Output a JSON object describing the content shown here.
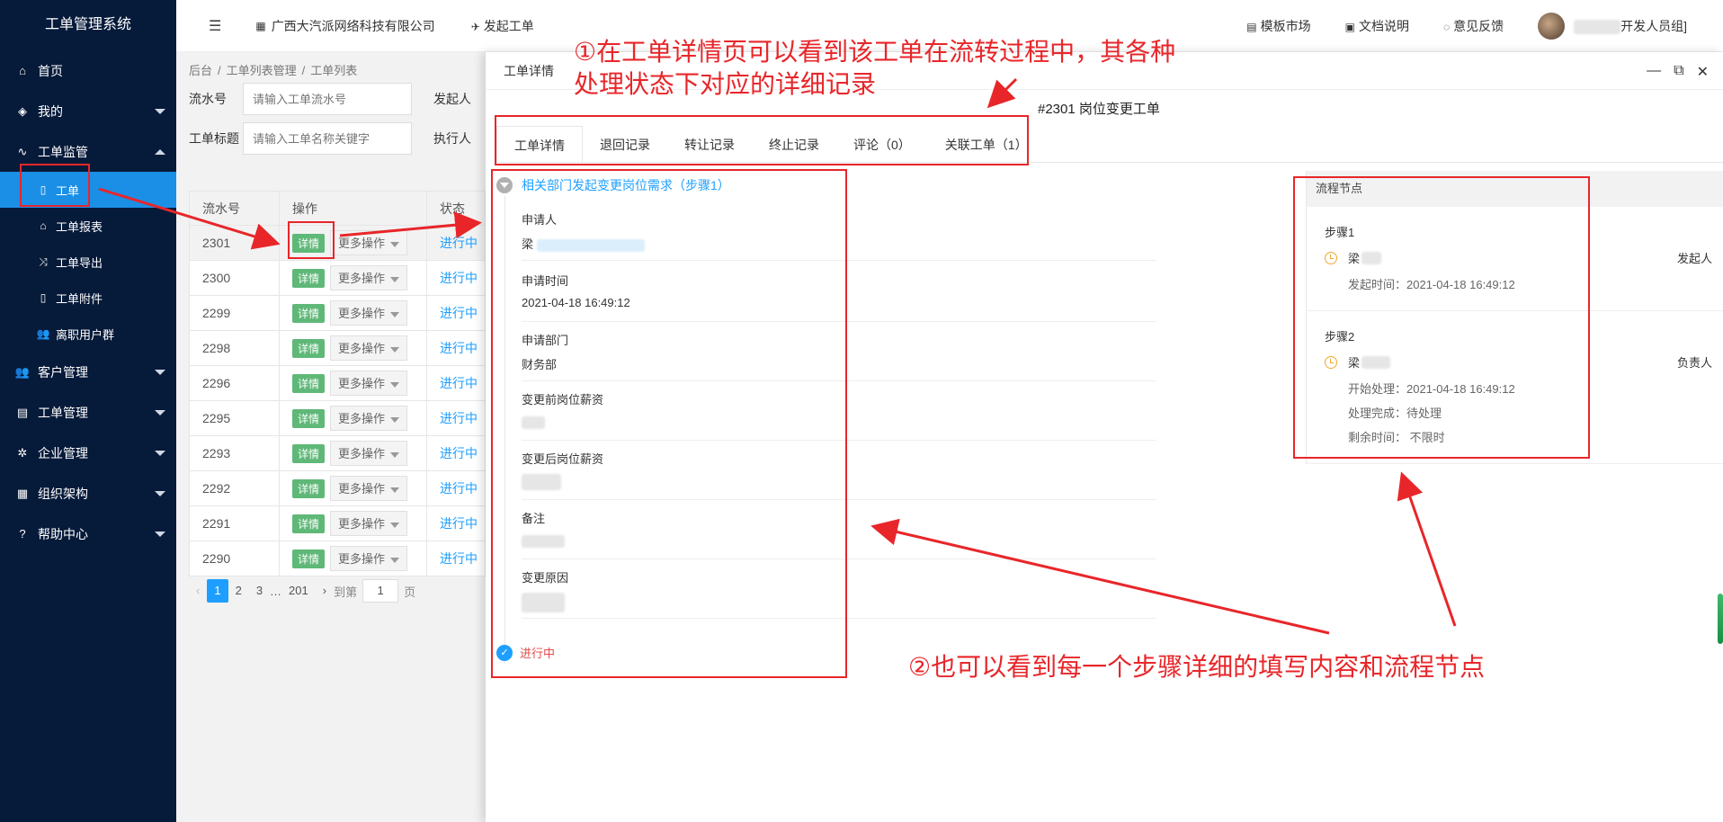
{
  "sidebar": {
    "brand": "工单管理系统",
    "items": [
      {
        "label": "首页",
        "icon": "home-icon",
        "glyph": "⌂"
      },
      {
        "label": "我的",
        "icon": "layers-icon",
        "glyph": "◈"
      },
      {
        "label": "工单监管",
        "icon": "pulse-icon",
        "glyph": "∿"
      },
      {
        "label": "客户管理",
        "icon": "users-icon",
        "glyph": "👥"
      },
      {
        "label": "工单管理",
        "icon": "clipboard-icon",
        "glyph": "▤"
      },
      {
        "label": "企业管理",
        "icon": "gear-icon",
        "glyph": "✲"
      },
      {
        "label": "组织架构",
        "icon": "calendar-icon",
        "glyph": "▦"
      },
      {
        "label": "帮助中心",
        "icon": "question-icon",
        "glyph": "?"
      }
    ],
    "sub_items": [
      {
        "label": "工单",
        "icon": "document-icon",
        "glyph": "▯"
      },
      {
        "label": "工单报表",
        "icon": "home-outline-icon",
        "glyph": "⌂"
      },
      {
        "label": "工单导出",
        "icon": "export-icon",
        "glyph": "⤨"
      },
      {
        "label": "工单附件",
        "icon": "file-icon",
        "glyph": "▯"
      },
      {
        "label": "离职用户群",
        "icon": "users-icon",
        "glyph": "👥"
      }
    ]
  },
  "header": {
    "company": "广西大汽派网络科技有限公司",
    "launch": "发起工单",
    "links": [
      "模板市场",
      "文档说明",
      "意见反馈"
    ],
    "user_suffix": "开发人员组]"
  },
  "list": {
    "breadcrumb": [
      "后台",
      "工单列表管理",
      "工单列表"
    ],
    "filter_serial_label": "流水号",
    "filter_serial_placeholder": "请输入工单流水号",
    "filter_initiator_label": "发起人",
    "filter_title_label": "工单标题",
    "filter_title_placeholder": "请输入工单名称关键字",
    "filter_executor_label": "执行人",
    "columns": [
      "流水号",
      "操作",
      "状态"
    ],
    "detail_label": "详情",
    "more_label": "更多操作",
    "rows": [
      {
        "id": "2301",
        "status": "进行中"
      },
      {
        "id": "2300",
        "status": "进行中"
      },
      {
        "id": "2299",
        "status": "进行中"
      },
      {
        "id": "2298",
        "status": "进行中"
      },
      {
        "id": "2296",
        "status": "进行中"
      },
      {
        "id": "2295",
        "status": "进行中"
      },
      {
        "id": "2293",
        "status": "进行中"
      },
      {
        "id": "2292",
        "status": "进行中"
      },
      {
        "id": "2291",
        "status": "进行中"
      },
      {
        "id": "2290",
        "status": "进行中"
      }
    ],
    "pager": {
      "pages": [
        "1",
        "2",
        "3",
        "…",
        "201"
      ],
      "goto_label": "到第",
      "goto_value": "1",
      "page_unit": "页"
    }
  },
  "drawer": {
    "title": "工单详情",
    "work_order_title": "#2301 岗位变更工单",
    "tabs": [
      "工单详情",
      "退回记录",
      "转让记录",
      "终止记录",
      "评论（0）",
      "关联工单（1）"
    ],
    "step_title": "相关部门发起变更岗位需求（步骤1）",
    "fields": [
      {
        "key": "申请人",
        "value": "梁"
      },
      {
        "key": "申请时间",
        "value": "2021-04-18 16:49:12"
      },
      {
        "key": "申请部门",
        "value": "财务部"
      },
      {
        "key": "变更前岗位薪资",
        "value": ""
      },
      {
        "key": "变更后岗位薪资",
        "value": ""
      },
      {
        "key": "备注",
        "value": ""
      },
      {
        "key": "变更原因",
        "value": ""
      }
    ],
    "status": "进行中",
    "flow": {
      "header": "流程节点",
      "nodes": [
        {
          "step": "步骤1",
          "person": "梁",
          "role": "发起人",
          "meta": [
            "发起时间：2021-04-18 16:49:12"
          ]
        },
        {
          "step": "步骤2",
          "person": "梁",
          "role": "负责人",
          "meta": [
            "开始处理：2021-04-18 16:49:12",
            "处理完成：待处理",
            "剩余时间： 不限时"
          ]
        }
      ]
    }
  },
  "annotations": {
    "note1": "①在工单详情页可以看到该工单在流转过程中，其各种处理状态下对应的详细记录",
    "note1_line1": "①在工单详情页可以看到该工单在流转过程中，其各种",
    "note1_line2": "处理状态下对应的详细记录",
    "note2": "②也可以看到每一个步骤详细的填写内容和流程节点"
  },
  "colors": {
    "sidebar_bg": "#061a3a",
    "active": "#1b8fe6",
    "accent_red": "#e8262a",
    "status_blue": "#1e9fff",
    "detail_green": "#5fb878"
  }
}
